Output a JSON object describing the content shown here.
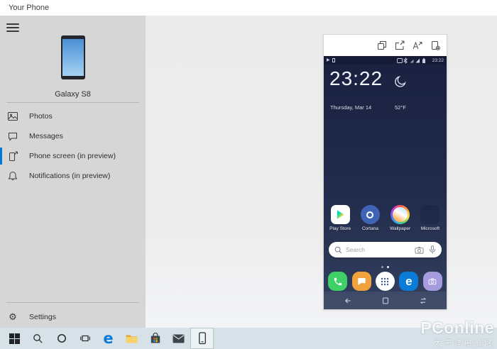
{
  "window": {
    "title": "Your Phone"
  },
  "sidebar": {
    "device_name": "Galaxy S8",
    "items": [
      {
        "label": "Photos",
        "icon": "photos-icon",
        "selected": false
      },
      {
        "label": "Messages",
        "icon": "messages-icon",
        "selected": false
      },
      {
        "label": "Phone screen (in preview)",
        "icon": "phone-screen-icon",
        "selected": true
      },
      {
        "label": "Notifications (in preview)",
        "icon": "notifications-icon",
        "selected": false
      }
    ],
    "settings_label": "Settings"
  },
  "phone_mirror": {
    "toolbar_icons": [
      "screenshot-icon",
      "open-external-icon",
      "text-size-icon",
      "page-settings-icon"
    ],
    "status": {
      "time": "23:22"
    },
    "clock": {
      "time": "23:22",
      "date": "Thursday, Mar 14",
      "temperature": "52°F",
      "weather_icon": "crescent-moon-icon"
    },
    "home_apps": [
      {
        "label": "Play Store",
        "icon": "play-store-icon"
      },
      {
        "label": "Cortana",
        "icon": "cortana-icon"
      },
      {
        "label": "Wallpaper",
        "icon": "wallpaper-icon"
      },
      {
        "label": "Microsoft",
        "icon": "microsoft-folder-icon"
      }
    ],
    "search": {
      "placeholder": "Search",
      "icons": [
        "magnifier-icon",
        "camera-icon",
        "microphone-icon"
      ]
    },
    "dock_apps": [
      "phone-icon",
      "messages-icon",
      "app-drawer-icon",
      "edge-icon",
      "camera-icon"
    ],
    "nav_buttons": [
      "back",
      "home",
      "recents"
    ]
  },
  "taskbar": {
    "items": [
      "start",
      "search",
      "cortana",
      "task-view",
      "edge",
      "file-explorer",
      "microsoft-store",
      "mail",
      "your-phone"
    ],
    "active_item": "your-phone"
  },
  "watermark": {
    "title": "PConline",
    "subtitle": "太平洋电脑网"
  },
  "colors": {
    "accent": "#0078d7",
    "sidebar_bg": "#d6d6d6",
    "main_bg": "#ececec",
    "phone_screen_top": "#1a2140",
    "phone_screen_bottom": "#33405f",
    "taskbar_bg": "#d7e2e8"
  }
}
